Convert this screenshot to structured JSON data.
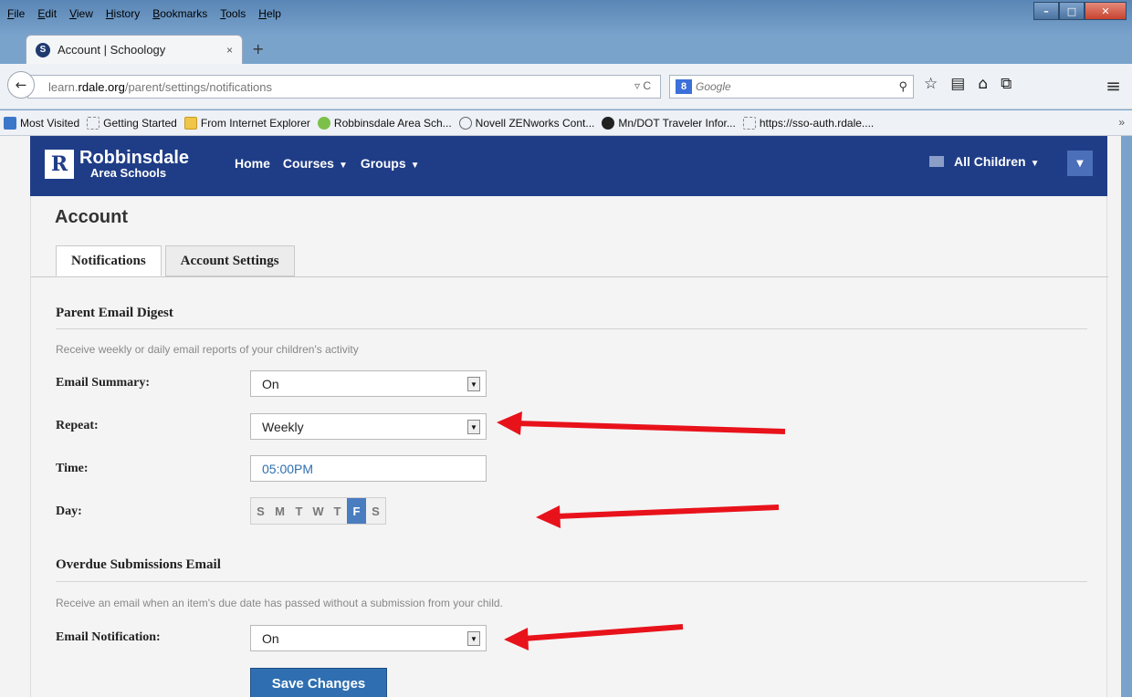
{
  "browser": {
    "menu": [
      "File",
      "Edit",
      "View",
      "History",
      "Bookmarks",
      "Tools",
      "Help"
    ],
    "tab_title": "Account | Schoology",
    "tab_favicon": "S",
    "new_tab": "+",
    "tab_close": "×",
    "url_prefix": "learn.",
    "url_host": "rdale.org",
    "url_path": "/parent/settings/notifications",
    "url_tools": "▿ C",
    "search_engine": "8",
    "search_placeholder": "Google",
    "bookmarks": [
      {
        "label": "Most Visited",
        "icon": "page-icon"
      },
      {
        "label": "Getting Started",
        "icon": "blank-icon"
      },
      {
        "label": "From Internet Explorer",
        "icon": "folder-icon"
      },
      {
        "label": "Robbinsdale Area Sch...",
        "icon": "apple-icon"
      },
      {
        "label": "Novell ZENworks Cont...",
        "icon": "novell-icon"
      },
      {
        "label": "Mn/DOT Traveler Infor...",
        "icon": "mndot-icon"
      },
      {
        "label": "https://sso-auth.rdale....",
        "icon": "blank-icon"
      }
    ],
    "bookmarks_more": "»"
  },
  "site": {
    "logo_mark": "R",
    "logo_line1": "Robbinsdale",
    "logo_line2": "Area Schools",
    "nav": [
      "Home",
      "Courses",
      "Groups"
    ],
    "children_label": "All Children"
  },
  "account": {
    "title": "Account",
    "tabs": [
      "Notifications",
      "Account Settings"
    ],
    "digest": {
      "title": "Parent Email Digest",
      "description": "Receive weekly or daily email reports of your children's activity",
      "email_summary_label": "Email Summary:",
      "email_summary_value": "On",
      "repeat_label": "Repeat:",
      "repeat_value": "Weekly",
      "time_label": "Time:",
      "time_value": "05:00PM",
      "day_label": "Day:",
      "days": [
        "S",
        "M",
        "T",
        "W",
        "T",
        "F",
        "S"
      ],
      "selected_day": "F"
    },
    "overdue": {
      "title": "Overdue Submissions Email",
      "description": "Receive an email when an item's due date has passed without a submission from your child.",
      "email_notification_label": "Email Notification:",
      "email_notification_value": "On"
    },
    "save_label": "Save Changes"
  },
  "colors": {
    "brand": "#1f3d87",
    "accent": "#2f6fb1",
    "annotation_arrow": "#e8121b"
  }
}
